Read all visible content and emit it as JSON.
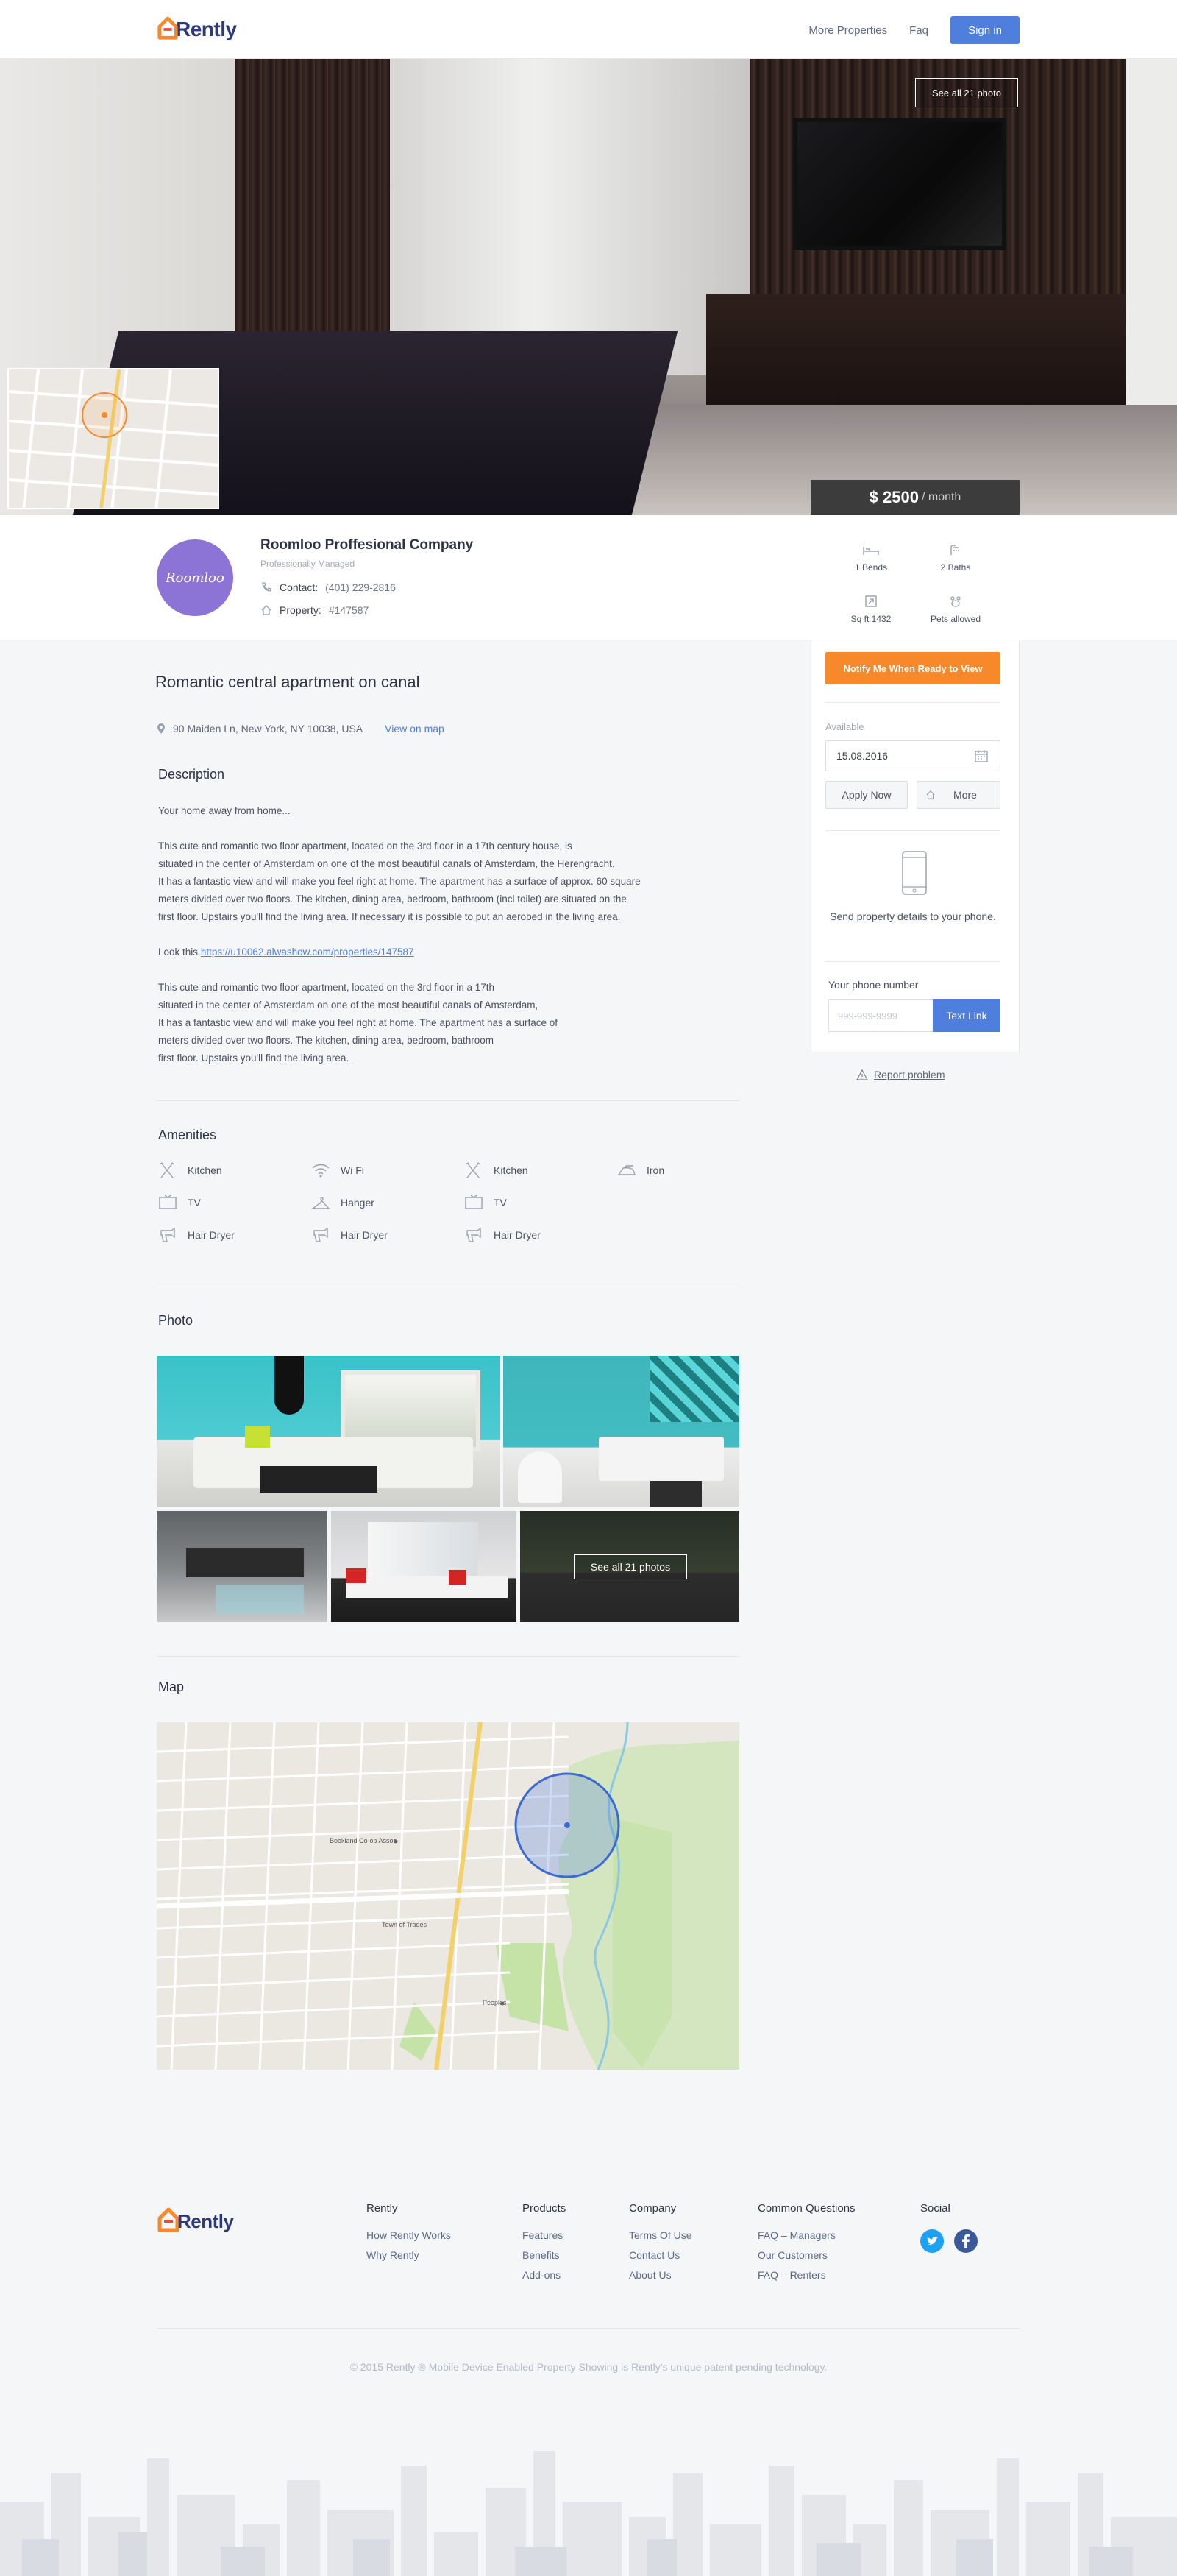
{
  "header": {
    "logo_text": "Rently",
    "nav": [
      "More Properties",
      "Faq"
    ],
    "signin_label": "Sign in"
  },
  "hero": {
    "see_all_label": "See all 21 photo"
  },
  "pricing": {
    "price": "$ 2500",
    "period": "/ month"
  },
  "company": {
    "avatar_text": "Roomloo",
    "name": "Roomloo Proffesional Company",
    "subtitle": "Professionally Managed",
    "contact_label": "Contact:",
    "contact_value": "(401) 229-2816",
    "property_label": "Property:",
    "property_value": "#147587"
  },
  "facts": [
    {
      "label": "1 Bends",
      "icon": "bed-icon"
    },
    {
      "label": "2 Baths",
      "icon": "shower-icon"
    },
    {
      "label": "Sq ft 1432",
      "icon": "resize-icon"
    },
    {
      "label": "Pets allowed",
      "icon": "paw-icon"
    }
  ],
  "side": {
    "notify_label": "Notify Me When Ready to View",
    "available_label": "Available",
    "date_value": "15.08.2016",
    "apply_label": "Apply Now",
    "more_label": "More",
    "send_text": "Send property details to your phone.",
    "phone_label": "Your phone number",
    "phone_placeholder": "999-999-9999",
    "text_link_label": "Text Link",
    "report_label": "Report problem"
  },
  "listing": {
    "title": "Romantic central apartment on canal",
    "address": "90 Maiden Ln, New York, NY 10038, USA",
    "view_on_map": "View on map"
  },
  "description": {
    "heading": "Description",
    "intro": "Your home away from home...",
    "para1_lines": [
      "This cute and romantic two floor apartment, located on the 3rd floor in a 17th century house, is",
      "situated in the center of Amsterdam on one of the most beautiful canals of Amsterdam, the Herengracht.",
      "It has a fantastic view and will make you feel right at home. The apartment has a surface of approx. 60 square",
      "meters divided over two floors. The kitchen, dining area, bedroom, bathroom (incl toilet) are situated on the",
      "first floor. Upstairs you'll find the living area. If necessary it is possible to put an aerobed in the living area."
    ],
    "look_prefix": "Look this",
    "look_link": "https://u10062.alwashow.com/properties/147587",
    "para2_lines": [
      "This cute and romantic two floor apartment, located on the 3rd floor in a 17th",
      "situated in the center of Amsterdam on one of the most beautiful canals of Amsterdam,",
      "It has a fantastic view and will make you feel right at home. The apartment has a surface of",
      "meters divided over two floors. The kitchen, dining area, bedroom, bathroom",
      "first floor. Upstairs you'll find the living area."
    ]
  },
  "amenities": {
    "heading": "Amenities",
    "items": [
      {
        "label": "Kitchen",
        "icon": "kitchen-icon"
      },
      {
        "label": "Wi Fi",
        "icon": "wifi-icon"
      },
      {
        "label": "Kitchen",
        "icon": "kitchen-icon"
      },
      {
        "label": "Iron",
        "icon": "iron-icon"
      },
      {
        "label": "TV",
        "icon": "tv-icon"
      },
      {
        "label": "Hanger",
        "icon": "hanger-icon"
      },
      {
        "label": "TV",
        "icon": "tv-icon"
      },
      {
        "label": "",
        "icon": ""
      },
      {
        "label": "Hair Dryer",
        "icon": "hair-dryer-icon"
      },
      {
        "label": "Hair Dryer",
        "icon": "hair-dryer-icon"
      },
      {
        "label": "Hair Dryer",
        "icon": "hair-dryer-icon"
      }
    ]
  },
  "photos": {
    "heading": "Photo",
    "see_all_label": "See all 21 photos"
  },
  "map": {
    "heading": "Map",
    "labels": [
      "Bookland Co-op Assoc",
      "Town of Trades",
      "Peoples"
    ]
  },
  "footer": {
    "logo_text": "Rently",
    "columns": [
      {
        "title": "Rently",
        "links": [
          "How Rently Works",
          "Why Rently"
        ]
      },
      {
        "title": "Products",
        "links": [
          "Features",
          "Benefits",
          "Add-ons"
        ]
      },
      {
        "title": "Company",
        "links": [
          "Terms Of Use",
          "Contact Us",
          "About Us"
        ]
      },
      {
        "title": "Common Questions",
        "links": [
          "FAQ – Managers",
          "Our Customers",
          "FAQ – Renters"
        ]
      },
      {
        "title": "Social",
        "links": []
      }
    ],
    "copyright": "© 2015 Rently ® Mobile Device Enabled Property Showing is Rently's unique patent pending technology."
  },
  "colors": {
    "brand_blue": "#4f7fdd",
    "accent_orange": "#f7892b",
    "dark_price": "#3c3c3c"
  }
}
